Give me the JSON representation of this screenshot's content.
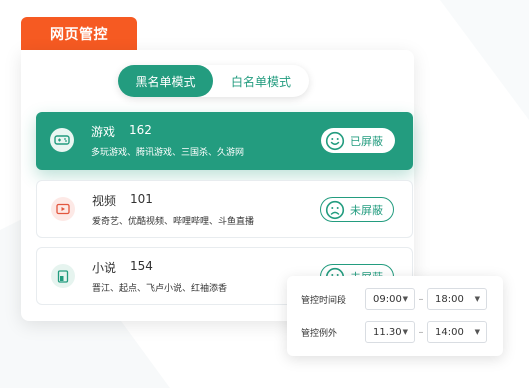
{
  "title_tab": "网页管控",
  "mode_toggle": {
    "active": "黑名单模式",
    "inactive": "白名单模式"
  },
  "categories": [
    {
      "name": "游戏",
      "count": "162",
      "sites": "多玩游戏、腾讯游戏、三国杀、久游网",
      "status": "已屏蔽",
      "icon": "gamepad-icon"
    },
    {
      "name": "视频",
      "count": "101",
      "sites": "爱奇艺、优酷视频、哔哩哔哩、斗鱼直播",
      "status": "未屏蔽",
      "icon": "video-icon"
    },
    {
      "name": "小说",
      "count": "154",
      "sites": "晋江、起点、飞卢小说、红袖添香",
      "status": "未屏蔽",
      "icon": "book-icon"
    }
  ],
  "time_popup": {
    "row1": {
      "label": "管控时间段",
      "start": "09:00",
      "end": "18:00"
    },
    "row2": {
      "label": "管控例外",
      "start": "11.30",
      "end": "14:00"
    },
    "separator": "–"
  },
  "colors": {
    "accent": "#239c7f",
    "brand_orange": "#f65a22"
  }
}
